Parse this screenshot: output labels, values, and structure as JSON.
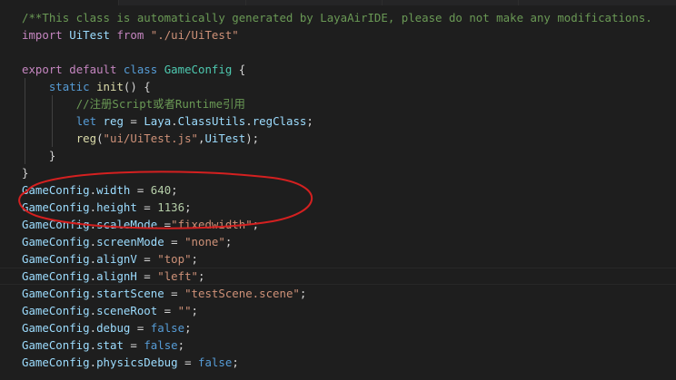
{
  "editor": {
    "lines": {
      "l1": {
        "comment": "/**This class is automatically generated by LayaAirIDE, please do not make any modifications."
      },
      "l2": {
        "kw_import": "import",
        "name": "UiTest",
        "kw_from": "from",
        "path": "\"./ui/UiTest\""
      },
      "l4": {
        "kw_export": "export",
        "kw_default": "default",
        "kw_class": "class",
        "class_name": "GameConfig",
        "brace": "{"
      },
      "l5": {
        "kw_static": "static",
        "method": "init",
        "rest": "() {"
      },
      "l6": {
        "comment": "//注册Script或者Runtime引用"
      },
      "l7": {
        "kw_let": "let",
        "var": "reg",
        "eq": " = ",
        "cls1": "Laya",
        "dot": ".",
        "cls2": "ClassUtils",
        "dot2": ".",
        "method": "regClass",
        "semi": ";"
      },
      "l8": {
        "fn": "reg",
        "open": "(",
        "str": "\"ui/UiTest.js\"",
        "comma": ",",
        "cls": "UiTest",
        "close": ");"
      },
      "l9": {
        "brace": "}"
      },
      "l10": {
        "brace": "}"
      },
      "l11": {
        "obj": "GameConfig",
        "dot": ".",
        "prop": "width",
        "eq": " = ",
        "val": "640",
        "semi": ";"
      },
      "l12": {
        "obj": "GameConfig",
        "dot": ".",
        "prop": "height",
        "eq": " = ",
        "val": "1136",
        "semi": ";"
      },
      "l13": {
        "obj": "GameConfig",
        "dot": ".",
        "prop": "scaleMode",
        "eq": " =",
        "val": "\"fixedwidth\"",
        "semi": ";"
      },
      "l14": {
        "obj": "GameConfig",
        "dot": ".",
        "prop": "screenMode",
        "eq": " = ",
        "val": "\"none\"",
        "semi": ";"
      },
      "l15": {
        "obj": "GameConfig",
        "dot": ".",
        "prop": "alignV",
        "eq": " = ",
        "val": "\"top\"",
        "semi": ";"
      },
      "l16": {
        "obj": "GameConfig",
        "dot": ".",
        "prop": "alignH",
        "eq": " = ",
        "val": "\"left\"",
        "semi": ";"
      },
      "l17": {
        "obj": "GameConfig",
        "dot": ".",
        "prop": "startScene",
        "eq": " = ",
        "val": "\"testScene.scene\"",
        "semi": ";"
      },
      "l18": {
        "obj": "GameConfig",
        "dot": ".",
        "prop": "sceneRoot",
        "eq": " = ",
        "val": "\"\"",
        "semi": ";"
      },
      "l19": {
        "obj": "GameConfig",
        "dot": ".",
        "prop": "debug",
        "eq": " = ",
        "val": "false",
        "semi": ";"
      },
      "l20": {
        "obj": "GameConfig",
        "dot": ".",
        "prop": "stat",
        "eq": " = ",
        "val": "false",
        "semi": ";"
      },
      "l21": {
        "obj": "GameConfig",
        "dot": ".",
        "prop": "physicsDebug",
        "eq": " = ",
        "val": "false",
        "semi": ";"
      }
    }
  },
  "colors": {
    "background": "#1e1e1e",
    "comment": "#6a9955",
    "keyword": "#569cd6",
    "control_keyword": "#c586c0",
    "string": "#ce9178",
    "number": "#b5cea8",
    "variable": "#9cdcfe",
    "type": "#4ec9b0",
    "function": "#dcdcaa",
    "annotation_ellipse": "#d42020"
  }
}
